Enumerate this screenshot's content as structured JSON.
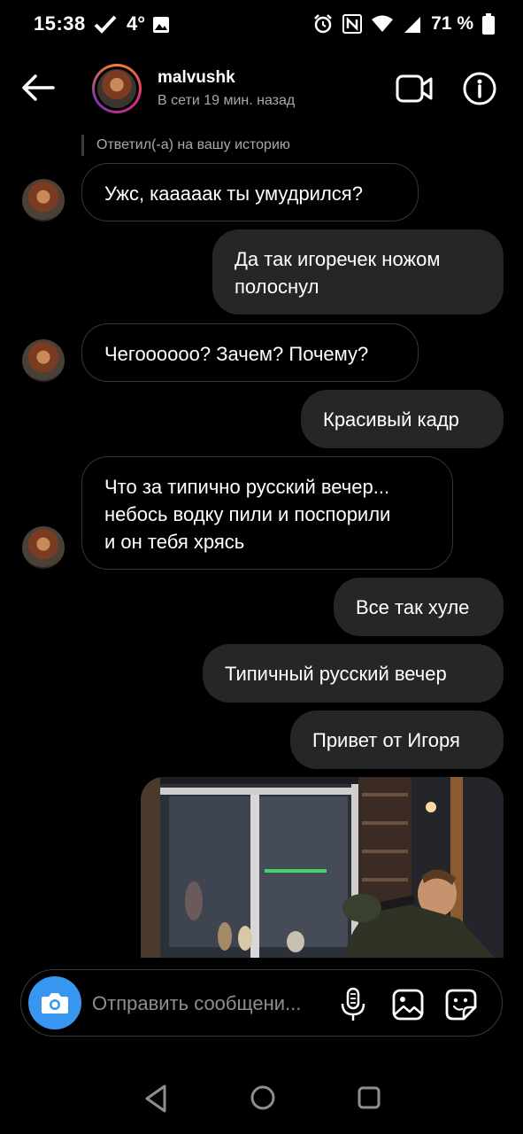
{
  "status_bar": {
    "time": "15:38",
    "temperature": "4°",
    "battery_percent": "71 %"
  },
  "header": {
    "username": "malvushk",
    "status": "В сети 19 мин. назад"
  },
  "reply_note": "Ответил(-а) на вашу историю",
  "messages": [
    {
      "from": "them",
      "lines": [
        "Ужс, кааааак ты умудрился?"
      ]
    },
    {
      "from": "me",
      "lines": [
        "Да так игоречек ножом",
        "полоснул"
      ]
    },
    {
      "from": "them",
      "lines": [
        "Чегоооооо? Зачем? Почему?"
      ]
    },
    {
      "from": "me",
      "lines": [
        "Красивый кадр"
      ]
    },
    {
      "from": "them",
      "lines": [
        "Что за типично русский вечер...",
        "небось водку пили и поспорили",
        "и он тебя хрясь"
      ]
    },
    {
      "from": "me",
      "lines": [
        "Все так хуле"
      ]
    },
    {
      "from": "me",
      "lines": [
        "Типичный русский вечер"
      ]
    },
    {
      "from": "me",
      "lines": [
        "Привет от Игоря"
      ]
    },
    {
      "from": "me",
      "type": "photo"
    }
  ],
  "composer": {
    "placeholder": "Отправить сообщени..."
  },
  "colors": {
    "accent": "#3797f0",
    "bubble_out": "#262626",
    "bubble_in_border": "#363636",
    "secondary_text": "#a8a8a8"
  },
  "icons": [
    "check-icon",
    "image-icon",
    "alarm-icon",
    "nfc-icon",
    "wifi-icon",
    "signal-icon",
    "battery-icon",
    "back-arrow-icon",
    "video-call-icon",
    "info-icon",
    "camera-icon",
    "microphone-icon",
    "gallery-icon",
    "sticker-icon",
    "nav-back-icon",
    "nav-home-icon",
    "nav-recents-icon"
  ]
}
